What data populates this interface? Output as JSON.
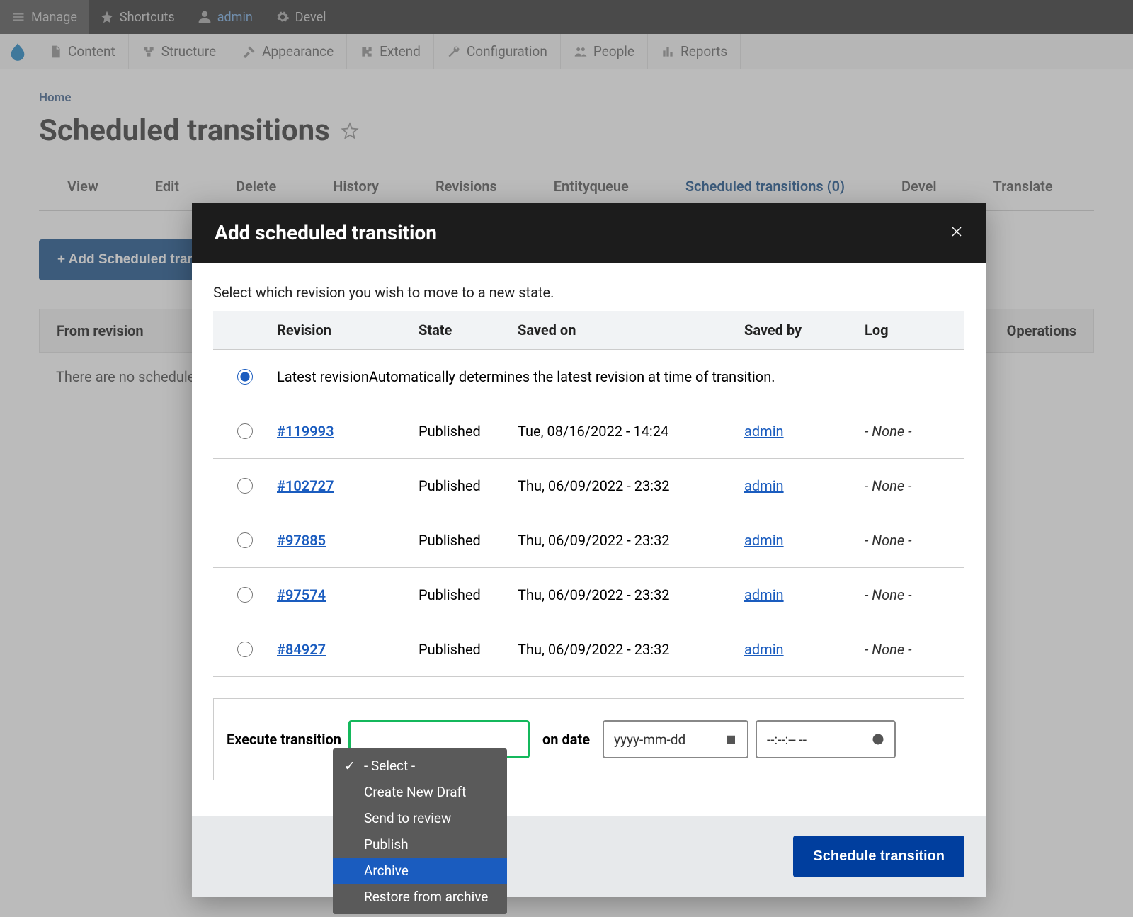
{
  "admin_bar": {
    "manage": "Manage",
    "shortcuts": "Shortcuts",
    "admin": "admin",
    "devel": "Devel"
  },
  "menu_bar": {
    "content": "Content",
    "structure": "Structure",
    "appearance": "Appearance",
    "extend": "Extend",
    "configuration": "Configuration",
    "people": "People",
    "reports": "Reports"
  },
  "breadcrumb": "Home",
  "page_title": "Scheduled transitions",
  "tabs": {
    "view": "View",
    "edit": "Edit",
    "delete": "Delete",
    "history": "History",
    "revisions": "Revisions",
    "entityqueue": "Entityqueue",
    "scheduled": "Scheduled transitions (0)",
    "devel": "Devel",
    "translate": "Translate"
  },
  "add_button": "+ Add Scheduled transition",
  "bg_table": {
    "from": "From revision",
    "ops": "Operations",
    "empty": "There are no scheduled transitions yet."
  },
  "modal": {
    "title": "Add scheduled transition",
    "instruction": "Select which revision you wish to move to a new state.",
    "headers": {
      "revision": "Revision",
      "state": "State",
      "saved_on": "Saved on",
      "saved_by": "Saved by",
      "log": "Log"
    },
    "latest": {
      "label": "Latest revision",
      "desc": "Automatically determines the latest revision at time of transition."
    },
    "rows": [
      {
        "id": "#119993",
        "state": "Published",
        "saved_on": "Tue, 08/16/2022 - 14:24",
        "by": "admin",
        "log": "- None -"
      },
      {
        "id": "#102727",
        "state": "Published",
        "saved_on": "Thu, 06/09/2022 - 23:32",
        "by": "admin",
        "log": "- None -"
      },
      {
        "id": "#97885",
        "state": "Published",
        "saved_on": "Thu, 06/09/2022 - 23:32",
        "by": "admin",
        "log": "- None -"
      },
      {
        "id": "#97574",
        "state": "Published",
        "saved_on": "Thu, 06/09/2022 - 23:32",
        "by": "admin",
        "log": "- None -"
      },
      {
        "id": "#84927",
        "state": "Published",
        "saved_on": "Thu, 06/09/2022 - 23:32",
        "by": "admin",
        "log": "- None -"
      }
    ],
    "execute_label_left": "Execute transition",
    "on_date_label": "on date",
    "date_placeholder": "yyyy-mm-dd",
    "time_placeholder": "--:--:-- --",
    "dropdown": {
      "select": "- Select -",
      "draft": "Create New Draft",
      "review": "Send to review",
      "publish": "Publish",
      "archive": "Archive",
      "restore": "Restore from archive"
    },
    "schedule_btn": "Schedule transition"
  }
}
